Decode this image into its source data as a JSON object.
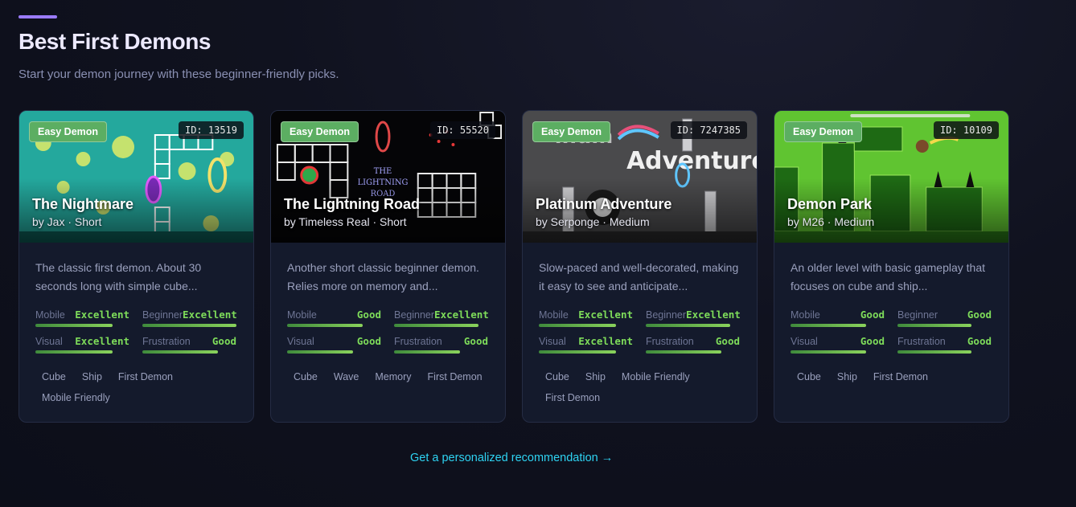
{
  "header": {
    "title": "Best First Demons",
    "subtitle": "Start your demon journey with these beginner-friendly picks."
  },
  "colors": {
    "accent": "#9b7bff",
    "badge": "#5cae62",
    "rating": "#7edc5a",
    "link": "#2ed3f2"
  },
  "cards": [
    {
      "badge": "Easy Demon",
      "id": "ID: 13519",
      "name": "The Nightmare",
      "byline": "by Jax · Short",
      "description": "The classic first demon. About 30 seconds long with simple cube...",
      "stats": [
        {
          "label": "Mobile",
          "value": "Excellent",
          "level": 0.82
        },
        {
          "label": "Beginner",
          "value": "Excellent",
          "level": 1.0
        },
        {
          "label": "Visual",
          "value": "Excellent",
          "level": 0.82
        },
        {
          "label": "Frustration",
          "value": "Good",
          "level": 0.8
        }
      ],
      "tags": [
        "Cube",
        "Ship",
        "First Demon",
        "Mobile Friendly"
      ]
    },
    {
      "badge": "Easy Demon",
      "id": "ID: 55520",
      "name": "The Lightning Road",
      "byline": "by Timeless Real · Short",
      "description": "Another short classic beginner demon. Relies more on memory and...",
      "stats": [
        {
          "label": "Mobile",
          "value": "Good",
          "level": 0.8
        },
        {
          "label": "Beginner",
          "value": "Excellent",
          "level": 0.9
        },
        {
          "label": "Visual",
          "value": "Good",
          "level": 0.7
        },
        {
          "label": "Frustration",
          "value": "Good",
          "level": 0.7
        }
      ],
      "tags": [
        "Cube",
        "Wave",
        "Memory",
        "First Demon"
      ]
    },
    {
      "badge": "Easy Demon",
      "id": "ID: 7247385",
      "name": "Platinum Adventure",
      "byline": "by Serponge · Medium",
      "description": "Slow-paced and well-decorated, making it easy to see and anticipate...",
      "stats": [
        {
          "label": "Mobile",
          "value": "Excellent",
          "level": 0.82
        },
        {
          "label": "Beginner",
          "value": "Excellent",
          "level": 0.9
        },
        {
          "label": "Visual",
          "value": "Excellent",
          "level": 0.82
        },
        {
          "label": "Frustration",
          "value": "Good",
          "level": 0.8
        }
      ],
      "tags": [
        "Cube",
        "Ship",
        "Mobile Friendly",
        "First Demon"
      ]
    },
    {
      "badge": "Easy Demon",
      "id": "ID: 10109",
      "name": "Demon Park",
      "byline": "by M26 · Medium",
      "description": "An older level with basic gameplay that focuses on cube and ship...",
      "stats": [
        {
          "label": "Mobile",
          "value": "Good",
          "level": 0.8
        },
        {
          "label": "Beginner",
          "value": "Good",
          "level": 0.79
        },
        {
          "label": "Visual",
          "value": "Good",
          "level": 0.8
        },
        {
          "label": "Frustration",
          "value": "Good",
          "level": 0.79
        }
      ],
      "tags": [
        "Cube",
        "Ship",
        "First Demon"
      ]
    }
  ],
  "cta": {
    "label": "Get a personalized recommendation →"
  }
}
